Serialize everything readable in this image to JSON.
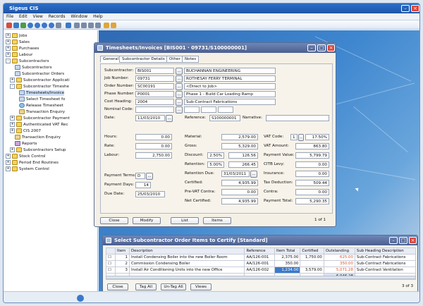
{
  "app": {
    "title": "Sigeus CIS",
    "menu": [
      "File",
      "Edit",
      "View",
      "Records",
      "Window",
      "Help"
    ]
  },
  "tree": {
    "items": [
      {
        "label": "Jobs",
        "expander": "+"
      },
      {
        "label": "Sales",
        "expander": "+"
      },
      {
        "label": "Purchases",
        "expander": "+"
      },
      {
        "label": "Labour",
        "expander": "+"
      },
      {
        "label": "Subcontractors",
        "expander": "-"
      },
      {
        "label": "Subcontractors"
      },
      {
        "label": "Subcontractor Orders"
      },
      {
        "label": "Subcontractor Applicati",
        "expander": "+"
      },
      {
        "label": "Subcontractor Timeshe",
        "expander": "-"
      },
      {
        "label": "Timesheets/Invoice"
      },
      {
        "label": "Select Timesheet fo"
      },
      {
        "label": "Release Timesheet"
      },
      {
        "label": "Transaction Enquiry"
      },
      {
        "label": "Subcontractor Payment",
        "expander": "+"
      },
      {
        "label": "Authenticated VAT Rec",
        "expander": "+"
      },
      {
        "label": "CIS 2007",
        "expander": "+"
      },
      {
        "label": "Transaction Enquiry"
      },
      {
        "label": "Reports"
      },
      {
        "label": "Subcontractors Setup",
        "expander": "+"
      },
      {
        "label": "Stock Control",
        "expander": "+"
      },
      {
        "label": "Period End Routines",
        "expander": "+"
      },
      {
        "label": "System Control",
        "expander": "+"
      }
    ]
  },
  "timesheet": {
    "title": "Timesheets/Invoices [BIS001 · 09731/S100000001]",
    "tabs": [
      "General",
      "Subcontractor Details",
      "Other",
      "Notes"
    ],
    "subcontractor_label": "Subcontractor:",
    "subcontractor_code": "BIS001",
    "subcontractor_name": "BUCHANNAN ENGINEERING",
    "job_label": "Job Number:",
    "job_code": "09731",
    "job_name": "ROTHESAY FERRY TERMINAL",
    "order_label": "Order Number:",
    "order_code": "SC00191",
    "order_name": "<Direct to Job>",
    "phase_label": "Phase Number:",
    "phase_code": "P0001",
    "phase_name": "Phase 1 - Build Car Loading Ramp",
    "cost_label": "Cost Heading:",
    "cost_code": "2004",
    "cost_name": "Sub-Contract Fabrications",
    "nominal_label": "Nominal Code:",
    "nominal_code": "",
    "date_label": "Date:",
    "date_value": "11/03/2010",
    "reference_label": "Reference:",
    "reference_value": "S100000001",
    "narrative_label": "Narrative:",
    "narrative_value": "",
    "hours_label": "Hours:",
    "hours_value": "0.00",
    "rate_label": "Rate:",
    "rate_value": "0.00",
    "labour_label": "Labour:",
    "labour_value": "2,750.00",
    "material_label": "Material:",
    "material_value": "2,579.00",
    "gross_label": "Gross:",
    "gross_value": "5,329.00",
    "discount_label": "Discount:",
    "discount_pct": "2.50%",
    "discount_value": "126.56",
    "retention_label": "Retention:",
    "retention_pct": "5.00%",
    "retention_value": "266.45",
    "retention_due_label": "Retention Due:",
    "retention_due_value": "31/03/2011",
    "certified_label": "Certified:",
    "certified_value": "4,935.99",
    "prevat_label": "Pre-VAT Contra:",
    "prevat_value": "0.00",
    "netcert_label": "Net Certified:",
    "netcert_value": "4,935.99",
    "vatcode_label": "VAT Code:",
    "vatcode_value": "1",
    "vat_pct": "17.50%",
    "vatamount_label": "VAT Amount:",
    "vatamount_value": "863.80",
    "payment_label": "Payment Value:",
    "payment_value": "5,799.79",
    "citb_label": "CITB Levy:",
    "citb_value": "0.00",
    "insurance_label": "Insurance:",
    "insurance_value": "0.00",
    "tax_label": "Tax Deduction:",
    "tax_value": "509.44",
    "contra_label": "Contra:",
    "contra_value": "0.00",
    "paytotal_label": "Payment Total:",
    "paytotal_value": "5,290.35",
    "paymentterms_label": "Payment Terms:",
    "paymentterms_value": "D",
    "paymentdays_label": "Payment Days:",
    "paymentdays_value": "14",
    "duedate_label": "Due Date:",
    "duedate_value": "25/03/2010",
    "buttons": {
      "close": "Close",
      "modify": "Modify",
      "list": "List",
      "items": "Items"
    },
    "pager": "1 of 1"
  },
  "certify": {
    "title": "Select Subcontractor Order Items to Certify [Standard]",
    "columns": [
      "Item",
      "Description",
      "Reference",
      "Item Total",
      "Certified",
      "Outstanding",
      "Sub Heading Description"
    ],
    "rows": [
      {
        "item": "1",
        "description": "Install Condensing Boiler into the new Boiler Room",
        "reference": "AA/126-001",
        "total": "2,375.00",
        "certified": "1,750.00",
        "outstanding": "625.00",
        "sub": "Sub-Contract Fabrications"
      },
      {
        "item": "2",
        "description": "Commission Condensing Boiler",
        "reference": "AA/126-001",
        "total": "350.00",
        "certified": "",
        "outstanding": "350.00",
        "sub": "Sub-Contract Fabrications"
      },
      {
        "item": "3",
        "description": "Install Air Conditioning Units into the new Office",
        "reference": "AA/126-002",
        "total": "1,234.00",
        "certified": "3,579.00",
        "outstanding": "5,071.28",
        "sub": "Sub-Contract Ventilation"
      }
    ],
    "total_outstanding": "6,046.28",
    "buttons": {
      "close": "Close",
      "tagall": "Tag All",
      "untagall": "Un-Tag All",
      "views": "Views"
    },
    "pager": "3 of 3"
  },
  "colors": {
    "accent": "#1d55a7",
    "dialog_title": "#4b5f8f",
    "outstanding": "#e0542a"
  }
}
